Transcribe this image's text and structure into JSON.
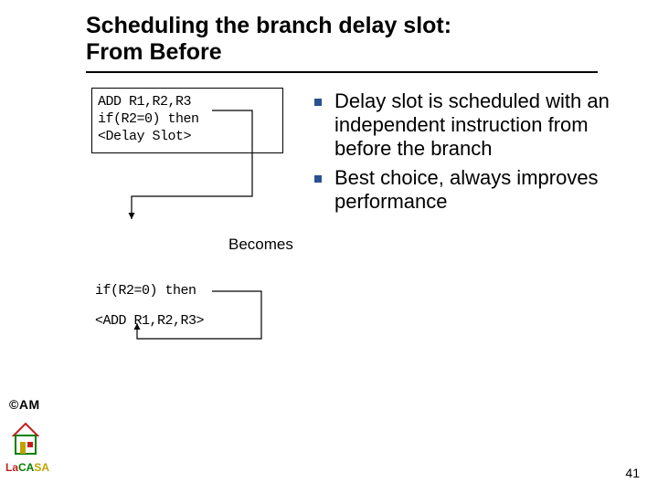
{
  "title": {
    "line1": "Scheduling the branch delay slot:",
    "line2": "From Before"
  },
  "code_box": {
    "l1": "ADD  R1,R2,R3",
    "l2": "if(R2=0) then",
    "l3": "<Delay Slot>"
  },
  "becomes_label": "Becomes",
  "lower_code": {
    "l1": "if(R2=0) then",
    "l2": "<ADD R1,R2,R3>"
  },
  "bullets": {
    "b1": "Delay slot is scheduled with an independent instruction from before the branch",
    "b2": "Best choice, always improves performance"
  },
  "logo": {
    "am_prefix": "©",
    "am_text": "AM",
    "lacasa_la": "La",
    "lacasa_ca": "CA",
    "lacasa_sa": "SA"
  },
  "page_number": "41"
}
